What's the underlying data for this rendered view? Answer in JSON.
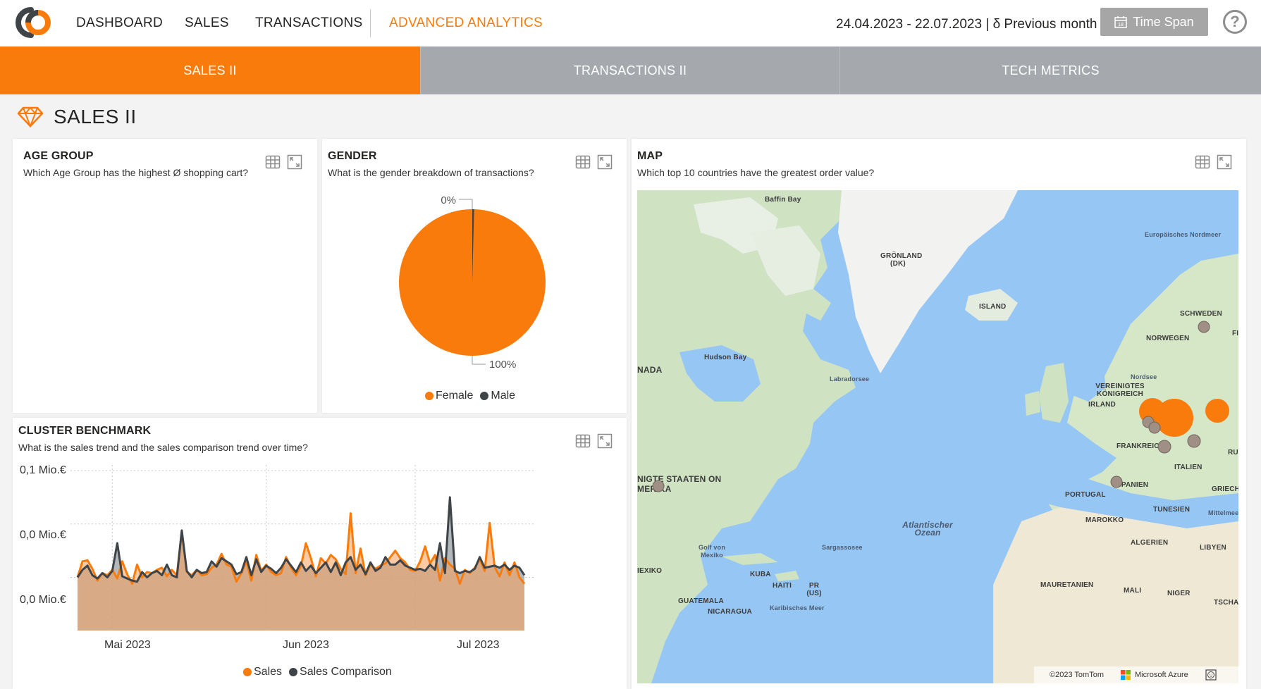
{
  "nav": {
    "items": [
      "DASHBOARD",
      "SALES",
      "TRANSACTIONS",
      "ADVANCED ANALYTICS"
    ],
    "active": "ADVANCED ANALYTICS"
  },
  "header": {
    "date_range": "24.04.2023 - 22.07.2023 | δ Previous month",
    "time_span_label": "Time Span",
    "help_symbol": "?"
  },
  "subtabs": [
    "SALES II",
    "TRANSACTIONS II",
    "TECH METRICS"
  ],
  "page": {
    "title": "SALES II"
  },
  "cards": {
    "age_group": {
      "title": "AGE GROUP",
      "subtitle": "Which Age Group has the highest Ø shopping cart?"
    },
    "gender": {
      "title": "GENDER",
      "subtitle": "What is the gender breakdown of transactions?"
    },
    "map": {
      "title": "MAP",
      "subtitle": "Which top 10 countries have the greatest order value?"
    },
    "cluster": {
      "title": "CLUSTER BENCHMARK",
      "subtitle": "What is the sales trend and the sales comparison trend over time?"
    }
  },
  "gender_chart": {
    "label_top": "0%",
    "label_bottom": "100%",
    "legend": [
      "Female",
      "Male"
    ],
    "colors": {
      "female": "#f97b0b",
      "male": "#3f4448"
    }
  },
  "chart_data": {
    "type": "area",
    "title": "CLUSTER BENCHMARK",
    "subtitle": "What is the sales trend and the sales comparison trend over time?",
    "y_tick_labels": [
      "0,1 Mio.€",
      "0,0 Mio.€",
      "0,0 Mio.€"
    ],
    "y_ticks": [
      0.1,
      0.05,
      0.0
    ],
    "ylim": [
      -0.03,
      0.1
    ],
    "x_tick_labels": [
      "Mai 2023",
      "Jun 2023",
      "Jul 2023"
    ],
    "x_tick_days": [
      7,
      38,
      68
    ],
    "x_range_days": [
      0,
      90
    ],
    "grid": true,
    "legend_position": "bottom",
    "series": [
      {
        "name": "Sales",
        "color": "#f97b0b",
        "values": [
          0.0,
          0.015,
          0.016,
          0.008,
          -0.003,
          0.004,
          0.002,
          0.007,
          -0.001,
          0.015,
          0.003,
          -0.006,
          0.012,
          0.0,
          0.005,
          0.004,
          0.007,
          0.009,
          0.001,
          0.007,
          0.002,
          0.043,
          0.005,
          0.002,
          0.007,
          0.002,
          0.003,
          0.009,
          0.012,
          0.022,
          0.012,
          0.01,
          -0.004,
          0.004,
          0.015,
          -0.003,
          0.021,
          0.006,
          0.012,
          0.005,
          0.002,
          0.004,
          0.019,
          0.009,
          0.002,
          0.011,
          0.032,
          0.018,
          0.001,
          0.018,
          0.013,
          0.021,
          0.017,
          0.008,
          0.003,
          0.06,
          0.004,
          0.027,
          0.002,
          0.012,
          0.008,
          0.011,
          0.013,
          0.019,
          0.025,
          0.018,
          0.014,
          0.007,
          0.006,
          0.015,
          0.029,
          0.013,
          0.021,
          -0.003,
          0.018,
          0.012,
          0.008,
          -0.006,
          0.007,
          0.004,
          0.009,
          0.017,
          0.006,
          0.051,
          0.01,
          0.001,
          0.014,
          0.002,
          0.014,
          0.0,
          -0.006
        ]
      },
      {
        "name": "Sales Comparison",
        "color": "#3f4448",
        "values": [
          0.0,
          0.007,
          0.011,
          0.002,
          -0.001,
          0.004,
          0.0,
          0.006,
          0.032,
          0.001,
          -0.001,
          -0.003,
          -0.004,
          0.005,
          0.0,
          0.004,
          0.006,
          0.002,
          0.012,
          0.002,
          0.0,
          0.044,
          0.006,
          0.0,
          0.007,
          0.004,
          0.005,
          0.015,
          0.01,
          0.018,
          0.015,
          0.012,
          0.003,
          0.005,
          0.019,
          0.002,
          0.017,
          0.005,
          0.011,
          0.008,
          0.004,
          0.009,
          0.017,
          0.011,
          0.005,
          0.014,
          0.006,
          0.011,
          0.004,
          0.009,
          0.014,
          0.005,
          0.014,
          0.002,
          0.014,
          0.019,
          0.007,
          0.012,
          0.003,
          0.014,
          0.006,
          0.009,
          0.019,
          0.012,
          0.012,
          0.016,
          0.011,
          0.009,
          0.007,
          0.008,
          0.006,
          0.012,
          0.007,
          0.032,
          0.004,
          0.075,
          0.006,
          0.004,
          0.006,
          0.005,
          0.008,
          0.019,
          0.009,
          0.01,
          0.011,
          0.009,
          0.012,
          0.007,
          0.011,
          0.009,
          0.002
        ]
      }
    ]
  },
  "map": {
    "labels": {
      "baffin_bay": "Baffin Bay",
      "greenland": "GRÖNLAND (DK)",
      "iceland": "ISLAND",
      "norwegian_sea": "Europäisches Nordmeer",
      "sweden": "SCHWEDEN",
      "norway": "NORWEGEN",
      "hudson_bay": "Hudson Bay",
      "canada": "NADA",
      "labrador": "Labradorsee",
      "north_sea": "Nordsee",
      "uk": "VEREINIGTES KÖNIGREICH",
      "ireland": "IRLAND",
      "france": "FRANKREICH",
      "italy": "ITALIEN",
      "usa": "NIGTE STAATEN ON MERIKA",
      "spain": "SPANIEN",
      "portugal": "PORTUGAL",
      "greece": "GRIECHEN",
      "tunisia": "TUNESIEN",
      "mediterranean": "Mittelmeer",
      "atlantic": "Atlantischer Ozean",
      "morocco": "MAROKKO",
      "algeria": "ALGERIEN",
      "libya": "LIBYEN",
      "gulf_mexico": "Golf von Mexiko",
      "sargasso": "Sargassosee",
      "mexico": "IEXIKO",
      "cuba": "KUBA",
      "haiti": "HAITI",
      "pr": "PR (US)",
      "mauritania": "MAURETANIEN",
      "mali": "MALI",
      "niger": "NIGER",
      "chad": "TSCHAD",
      "guatemala": "GUATEMALA",
      "nicaragua": "NICARAGUA",
      "caribbean": "Karibisches Meer",
      "romania_fragment": "RUM",
      "finland_fragment": "FI"
    },
    "attribution": "©2023 TomTom",
    "provider": "Microsoft Azure",
    "bubble_colors": {
      "top": "#f97b0b",
      "other": "#9f8f84"
    }
  }
}
